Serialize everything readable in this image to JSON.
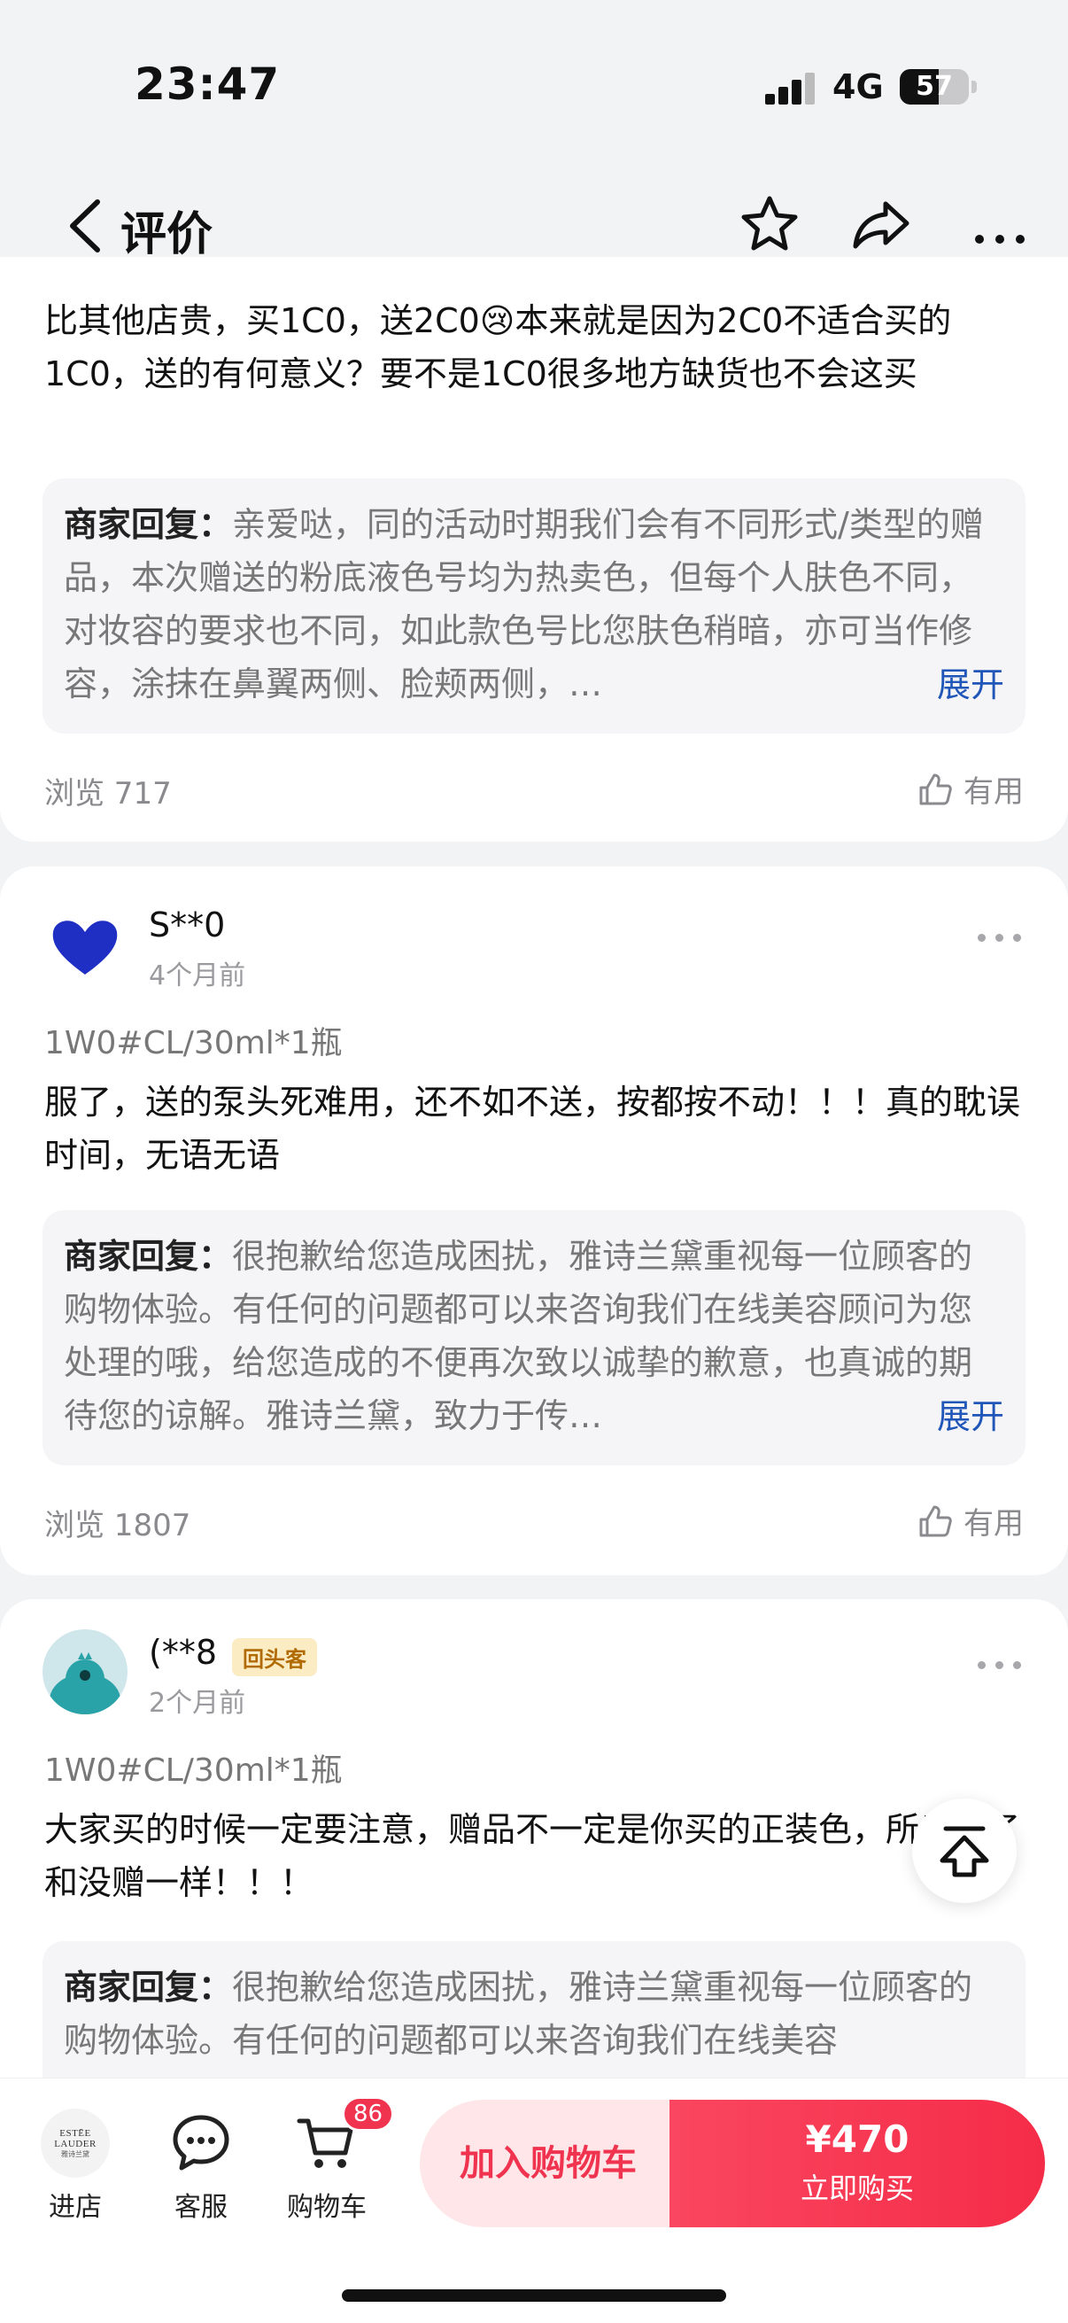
{
  "status_bar": {
    "time": "23:47",
    "network": "4G",
    "battery": "57",
    "battery_level": 0.57
  },
  "nav": {
    "title": "评价",
    "icons": [
      "back-icon",
      "star-icon",
      "share-icon",
      "more-icon"
    ]
  },
  "reviews": [
    {
      "text": "比其他店贵，买1C0，送2C0😢本来就是因为2C0不适合买的1C0，送的有何意义？要不是1C0很多地方缺货也不会这买",
      "reply_label": "商家回复：",
      "reply_text": "亲爱哒，同的活动时期我们会有不同形式/类型的赠品，本次赠送的粉底液色号均为热卖色，但每个人肤色不同，对妆容的要求也不同，如此款色号比您肤色稍暗，亦可当作修容，涂抹在鼻翼两侧、脸颊两侧，…",
      "expand": "展开",
      "views": "浏览 717",
      "useful": "有用"
    },
    {
      "user": "S**0",
      "time": "4个月前",
      "spec": "1W0#CL/30ml*1瓶",
      "text": "服了，送的泵头死难用，还不如不送，按都按不动！！！真的耽误时间，无语无语",
      "reply_label": "商家回复：",
      "reply_text": "很抱歉给您造成困扰，雅诗兰黛重视每一位顾客的购物体验。有任何的问题都可以来咨询我们在线美容顾问为您处理的哦，给您造成的不便再次致以诚挚的歉意，也真诚的期待您的谅解。雅诗兰黛，致力于传…",
      "expand": "展开",
      "views": "浏览 1807",
      "useful": "有用"
    },
    {
      "user": "(**8",
      "badge": "回头客",
      "time": "2个月前",
      "spec": "1W0#CL/30ml*1瓶",
      "text": "大家买的时候一定要注意，赠品不一定是你买的正装色，所以赠了和没赠一样！！！",
      "reply_label": "商家回复：",
      "reply_text": "很抱歉给您造成困扰，雅诗兰黛重视每一位顾客的购物体验。有任何的问题都可以来咨询我们在线美容"
    }
  ],
  "bottom_bar": {
    "store_logo_text": "ESTĒE LAUDER",
    "store_logo_sub": "雅诗兰黛",
    "store_label": "进店",
    "service_label": "客服",
    "cart_label": "购物车",
    "cart_count": "86",
    "add_to_cart": "加入购物车",
    "price": "¥470",
    "buy_now": "立即购买"
  },
  "colors": {
    "accent": "#f0344f",
    "link": "#1f56b8",
    "background": "#f2f3f5"
  }
}
